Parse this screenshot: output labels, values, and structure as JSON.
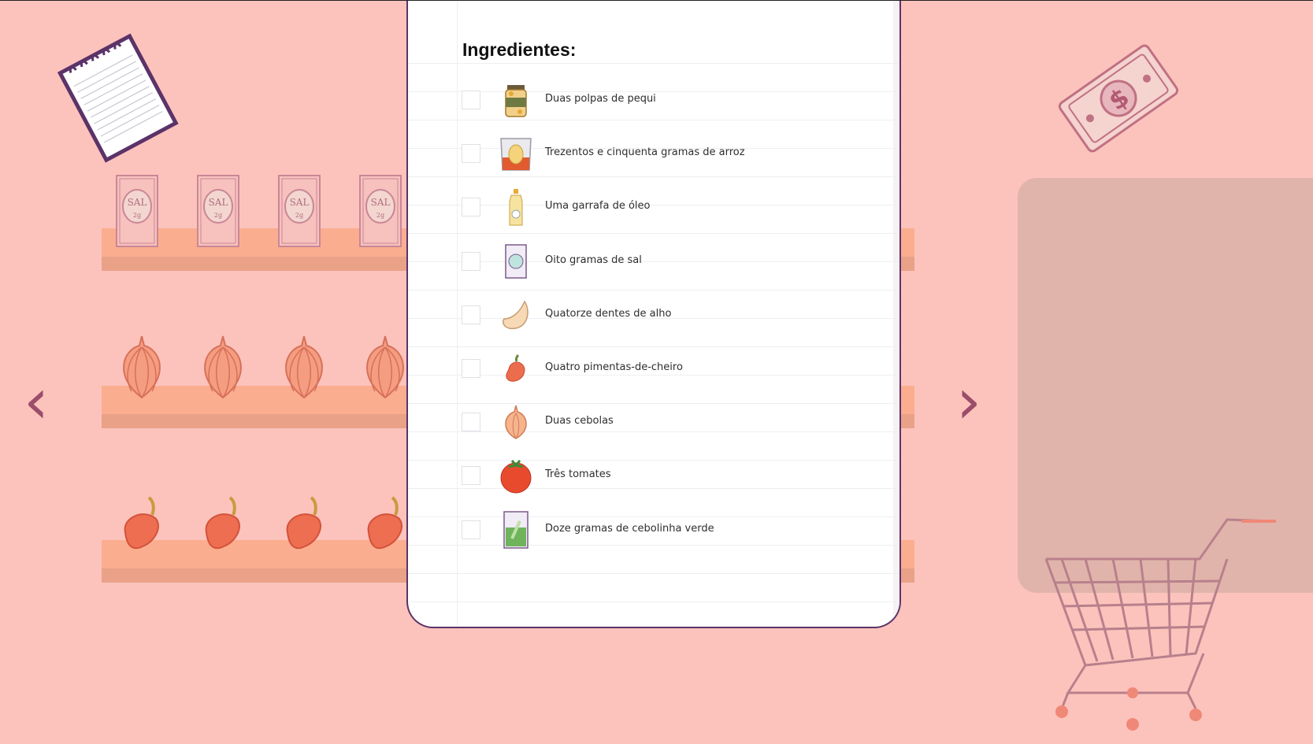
{
  "list_title": "Ingredientes:",
  "ingredients": [
    {
      "label": "Duas polpas de pequi",
      "icon": "pequi-jar-icon",
      "checked": false
    },
    {
      "label": "Trezentos e cinquenta gramas de arroz",
      "icon": "rice-bag-icon",
      "checked": false
    },
    {
      "label": "Uma garrafa de óleo",
      "icon": "oil-bottle-icon",
      "checked": false
    },
    {
      "label": "Oito gramas de sal",
      "icon": "salt-packet-icon",
      "checked": false
    },
    {
      "label": "Quatorze dentes de alho",
      "icon": "garlic-clove-icon",
      "checked": false
    },
    {
      "label": "Quatro pimentas-de-cheiro",
      "icon": "pepper-icon",
      "checked": false
    },
    {
      "label": "Duas cebolas",
      "icon": "onion-icon",
      "checked": false
    },
    {
      "label": "Três tomates",
      "icon": "tomato-icon",
      "checked": false
    },
    {
      "label": "Doze gramas de cebolinha verde",
      "icon": "chives-packet-icon",
      "checked": false
    }
  ],
  "shelves": [
    {
      "product": "salt-packet",
      "label": "SAL",
      "sublabel": "2g"
    },
    {
      "product": "onion"
    },
    {
      "product": "pepper"
    }
  ],
  "navigation": {
    "prev": "‹",
    "next": "›"
  },
  "colors": {
    "background": "#fcc3bc",
    "shelf": "#fbad8f",
    "accent": "#9c4d6a",
    "paper_border": "#5b3368"
  }
}
